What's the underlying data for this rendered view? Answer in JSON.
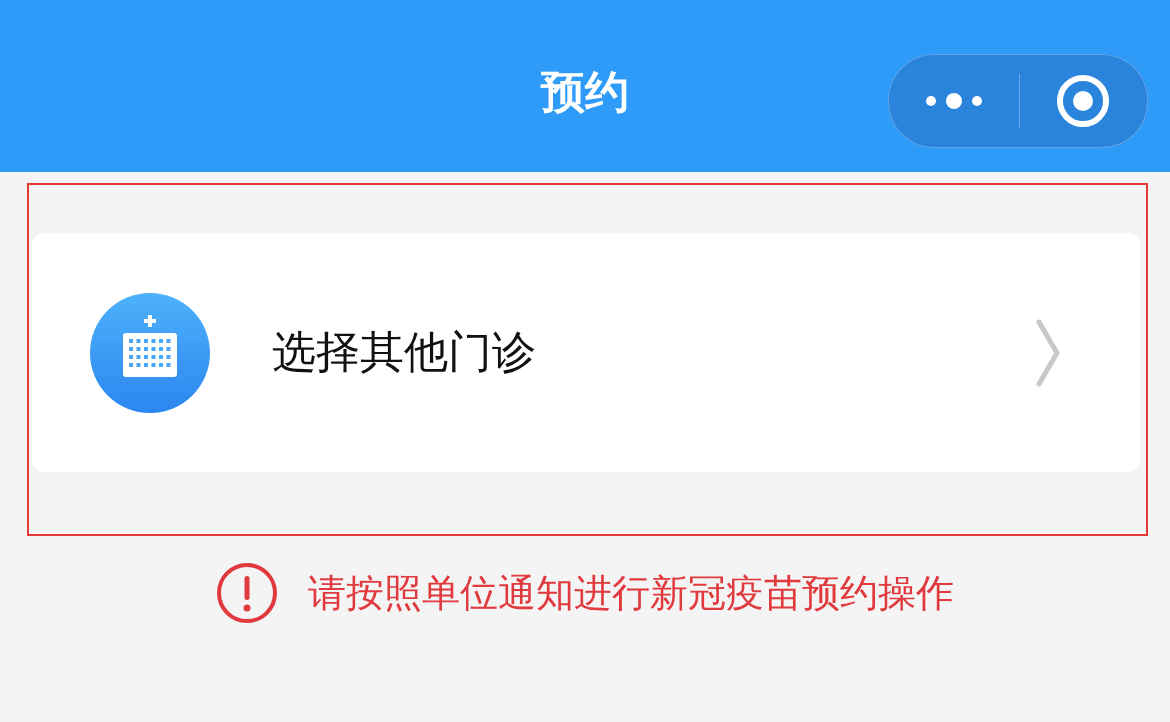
{
  "header": {
    "title": "预约"
  },
  "section": {
    "highlighted": true,
    "items": [
      {
        "label": "选择其他门诊"
      }
    ]
  },
  "notice": {
    "text": "请按照单位通知进行新冠疫苗预约操作"
  }
}
